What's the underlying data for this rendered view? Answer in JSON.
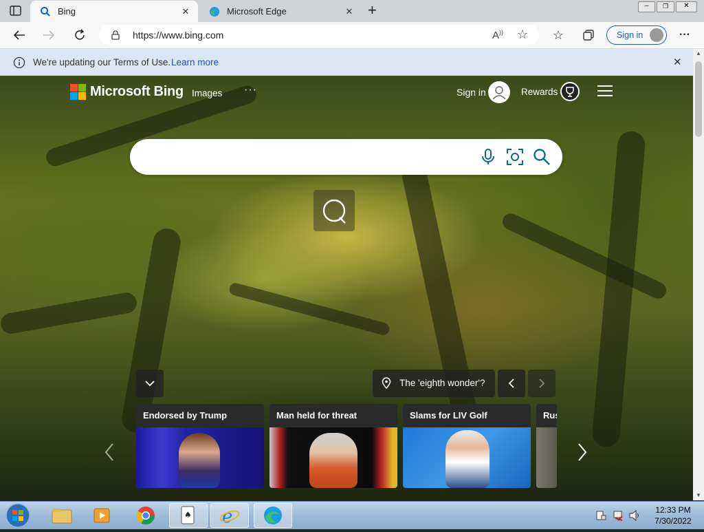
{
  "tabs": [
    {
      "label": "Bing",
      "active": true,
      "icon": "bing-search-icon"
    },
    {
      "label": "Microsoft Edge",
      "active": false,
      "icon": "edge-icon"
    }
  ],
  "address_bar": {
    "url": "https://www.bing.com"
  },
  "toolbar": {
    "sign_in_label": "Sign in"
  },
  "infobar": {
    "message": "We're updating our Terms of Use.",
    "link": "Learn more"
  },
  "bing_header": {
    "brand": "Microsoft Bing",
    "nav_images": "Images",
    "more": "···",
    "sign_in": "Sign in",
    "rewards": "Rewards"
  },
  "search": {
    "value": ""
  },
  "image_info": {
    "label": "The 'eighth wonder'?"
  },
  "news_cards": [
    {
      "title": "Endorsed by Trump"
    },
    {
      "title": "Man held for threat"
    },
    {
      "title": "Slams for LIV Golf"
    },
    {
      "title": "Rus"
    }
  ],
  "taskbar": {
    "apps": [
      "start",
      "file-explorer",
      "media-player",
      "chrome",
      "solitaire",
      "internet-explorer",
      "edge"
    ],
    "time": "12:33 PM",
    "date": "7/30/2022"
  },
  "colors": {
    "accent": "#1a5fb4",
    "bing_teal": "#0c6b8a",
    "infobar": "#dde7f4"
  }
}
